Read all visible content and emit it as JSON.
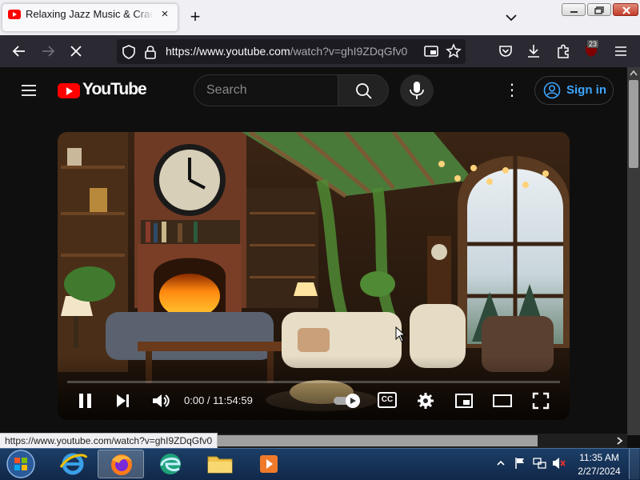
{
  "browser": {
    "tab_title": "Relaxing Jazz Music & Crackling Fireplace",
    "tab_close": "×",
    "new_tab": "+",
    "url_host": "https://www.youtube.com",
    "url_path": "/watch?v=ghI9ZDqGfv0",
    "extension_badge": "23",
    "status_url": "https://www.youtube.com/watch?v=ghI9ZDqGfv0"
  },
  "youtube": {
    "logo_text": "YouTube",
    "search_placeholder": "Search",
    "more_icon": "⋮",
    "sign_in": "Sign in"
  },
  "player": {
    "time_current": "0:00",
    "time_total": "11:54:59",
    "cc_label": "CC",
    "progress": 0
  },
  "taskbar": {
    "time": "11:35 AM",
    "date": "2/27/2024"
  },
  "colors": {
    "youtube_red": "#ff0000",
    "signin_blue": "#3ea6ff",
    "browser_dark": "#2b2a33"
  }
}
